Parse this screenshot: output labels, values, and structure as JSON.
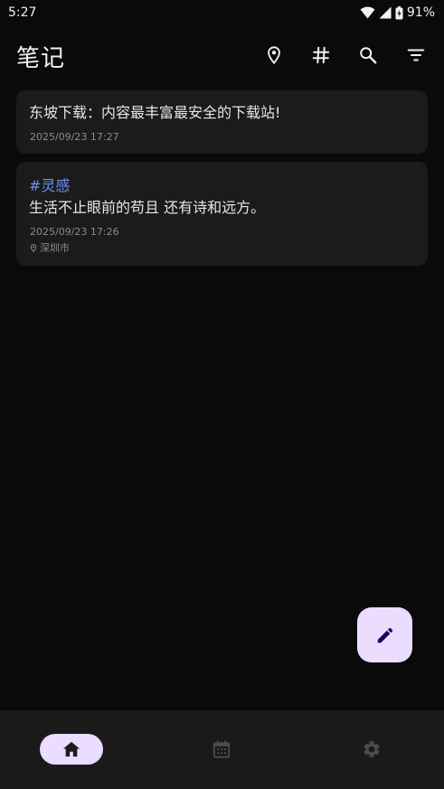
{
  "status_bar": {
    "time": "5:27",
    "battery": "91%",
    "icons": [
      "wifi-icon",
      "signal-icon",
      "battery-icon"
    ]
  },
  "app_bar": {
    "title": "笔记",
    "actions": [
      "location-icon",
      "hashtag-icon",
      "search-icon",
      "filter-icon"
    ]
  },
  "notes": [
    {
      "tag": "",
      "content": "东坡下载：内容最丰富最安全的下载站!",
      "time": "2025/09/23 17:27",
      "location": ""
    },
    {
      "tag": "#灵感",
      "content": "生活不止眼前的苟且 还有诗和远方。",
      "time": "2025/09/23 17:26",
      "location": "深圳市"
    }
  ],
  "fab": {
    "icon": "edit-icon"
  },
  "bottom_nav": {
    "items": [
      {
        "icon": "home-icon",
        "active": true
      },
      {
        "icon": "calendar-icon",
        "active": false
      },
      {
        "icon": "settings-icon",
        "active": false
      }
    ]
  },
  "colors": {
    "background": "#0a0a0a",
    "card": "#1b1b1b",
    "accent": "#eaddff",
    "accent_dark": "#21005d",
    "tag": "#6f8ff7",
    "nav_bar": "#1a1a1a"
  }
}
